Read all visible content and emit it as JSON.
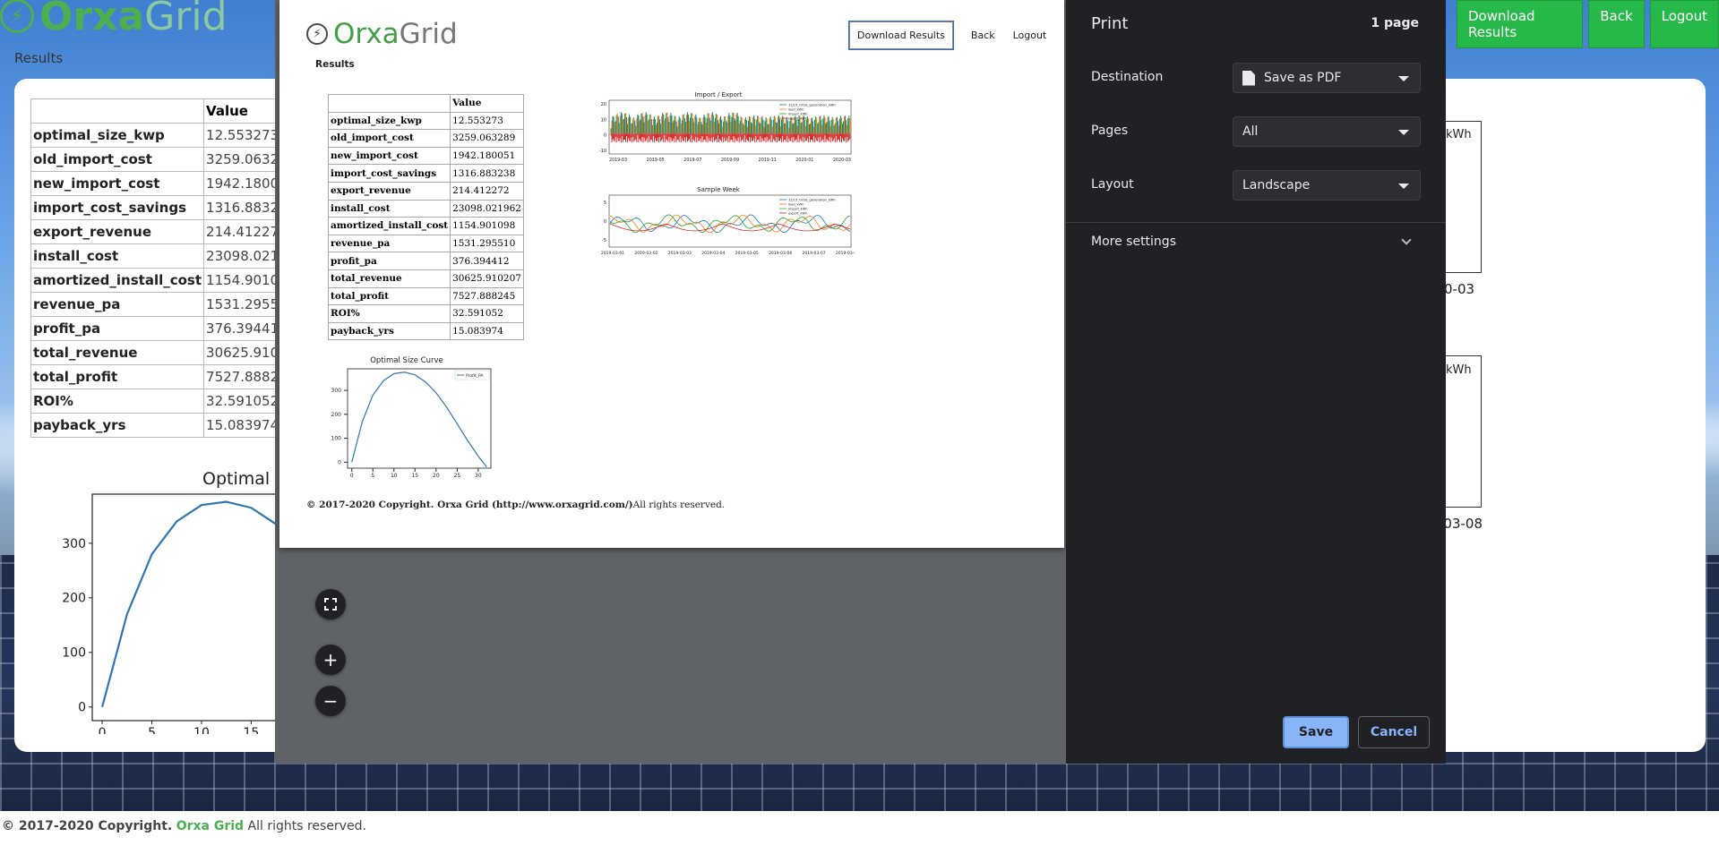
{
  "background": {
    "logo": {
      "word1": "Orxa",
      "word2": "Grid"
    },
    "results_label": "Results",
    "nav": {
      "download": "Download Results",
      "back": "Back",
      "logout": "Logout"
    },
    "table": {
      "header": "Value",
      "rows": [
        {
          "key": "optimal_size_kwp",
          "value": "12.553273"
        },
        {
          "key": "old_import_cost",
          "value": "3259.063289"
        },
        {
          "key": "new_import_cost",
          "value": "1942.180051"
        },
        {
          "key": "import_cost_savings",
          "value": "1316.883238"
        },
        {
          "key": "export_revenue",
          "value": "214.412272"
        },
        {
          "key": "install_cost",
          "value": "23098.021962"
        },
        {
          "key": "amortized_install_cost",
          "value": "1154.901098"
        },
        {
          "key": "revenue_pa",
          "value": "1531.295510"
        },
        {
          "key": "profit_pa",
          "value": "376.394412"
        },
        {
          "key": "total_revenue",
          "value": "30625.910207"
        },
        {
          "key": "total_profit",
          "value": "7527.888245"
        },
        {
          "key": "ROI%",
          "value": "32.591052"
        },
        {
          "key": "payback_yrs",
          "value": "15.083974"
        }
      ]
    },
    "chart_title_fragment": "Optimal S",
    "right_fragments": {
      "label1": "kWh",
      "label2": "kWh",
      "tick1": "0-03",
      "tick2": "-03-08"
    },
    "footer": {
      "prefix": "© 2017-2020 Copyright.",
      "brand": "Orxa Grid",
      "suffix": "All rights reserved."
    }
  },
  "preview": {
    "logo": {
      "word1": "Orxa",
      "word2": "Grid"
    },
    "nav": {
      "download": "Download Results",
      "back": "Back",
      "logout": "Logout"
    },
    "results_label": "Results",
    "import_export_title": "Import / Export",
    "sample_week_title": "Sample Week",
    "optimal_curve_title": "Optimal Size Curve",
    "footer": {
      "bold": "© 2017-2020 Copyright. Orxa Grid (http://www.orxagrid.com/)",
      "normal": "All rights reserved."
    }
  },
  "print_dialog": {
    "title": "Print",
    "page_count": "1 page",
    "destination_label": "Destination",
    "destination_value": "Save as PDF",
    "pages_label": "Pages",
    "pages_value": "All",
    "layout_label": "Layout",
    "layout_value": "Landscape",
    "more_settings": "More settings",
    "save": "Save",
    "cancel": "Cancel"
  },
  "chart_data": [
    {
      "type": "line",
      "title": "Optimal Size Curve",
      "legend": [
        "Profit_PA"
      ],
      "x": [
        0,
        2.5,
        5,
        7.5,
        10,
        12.5,
        15,
        17.5,
        20,
        22.5,
        25,
        27.5,
        30,
        32
      ],
      "series": [
        {
          "name": "Profit_PA",
          "values": [
            0,
            170,
            280,
            340,
            370,
            376,
            365,
            335,
            290,
            230,
            160,
            90,
            25,
            -20
          ]
        }
      ],
      "xticks": [
        0,
        5,
        10,
        15,
        20,
        25,
        30
      ],
      "yticks": [
        0,
        100,
        200,
        300
      ],
      "xlim": [
        -1,
        33
      ],
      "ylim": [
        -25,
        390
      ]
    },
    {
      "type": "area",
      "title": "Import / Export",
      "legend": [
        "12/15_Orbis_generation_kWh",
        "load_kWh",
        "import_kWh",
        "export_kWh"
      ],
      "xticks": [
        "2019-03",
        "2019-05",
        "2019-07",
        "2019-09",
        "2019-11",
        "2020-01",
        "2020-03"
      ],
      "yticks": [
        -10,
        0,
        10,
        20
      ]
    },
    {
      "type": "line",
      "title": "Sample Week",
      "legend": [
        "12/15_Orbis_generation_kWh",
        "load_kWh",
        "import_kWh",
        "export_kWh"
      ],
      "xticks": [
        "2019-03-01",
        "2019-03-02",
        "2019-03-03",
        "2019-03-04",
        "2019-03-05",
        "2019-03-06",
        "2019-03-07",
        "2019-03-08"
      ],
      "yticks": [
        -5,
        0,
        5
      ]
    }
  ]
}
